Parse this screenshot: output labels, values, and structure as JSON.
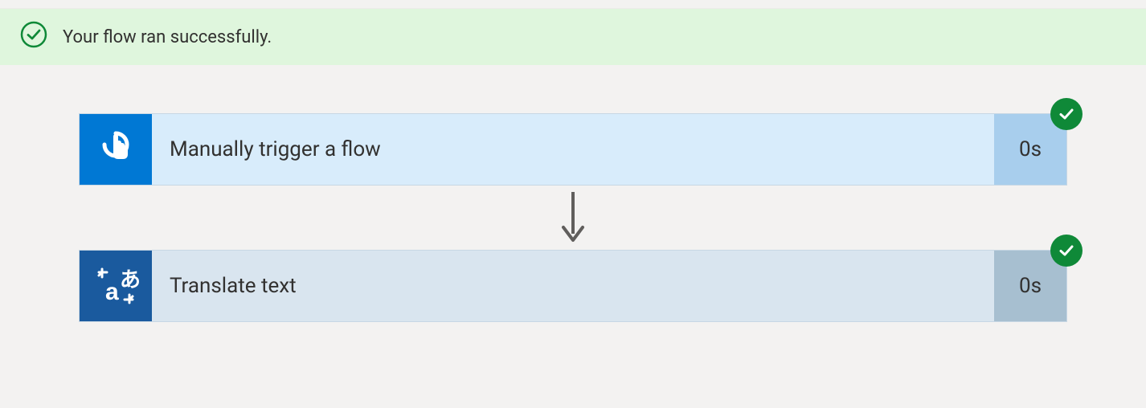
{
  "banner": {
    "message": "Your flow ran successfully."
  },
  "steps": [
    {
      "title": "Manually trigger a flow",
      "duration": "0s"
    },
    {
      "title": "Translate text",
      "duration": "0s"
    }
  ],
  "colors": {
    "banner_bg": "#dff6dd",
    "success_green": "#0f8938",
    "step1_icon_bg": "#0078d4",
    "step2_icon_bg": "#1a5a9e"
  },
  "icons": {
    "banner": "check-circle-outline-icon",
    "step_badge": "check-circle-icon",
    "step1": "touch-trigger-icon",
    "step2": "translate-icon",
    "arrow": "arrow-down-icon"
  }
}
